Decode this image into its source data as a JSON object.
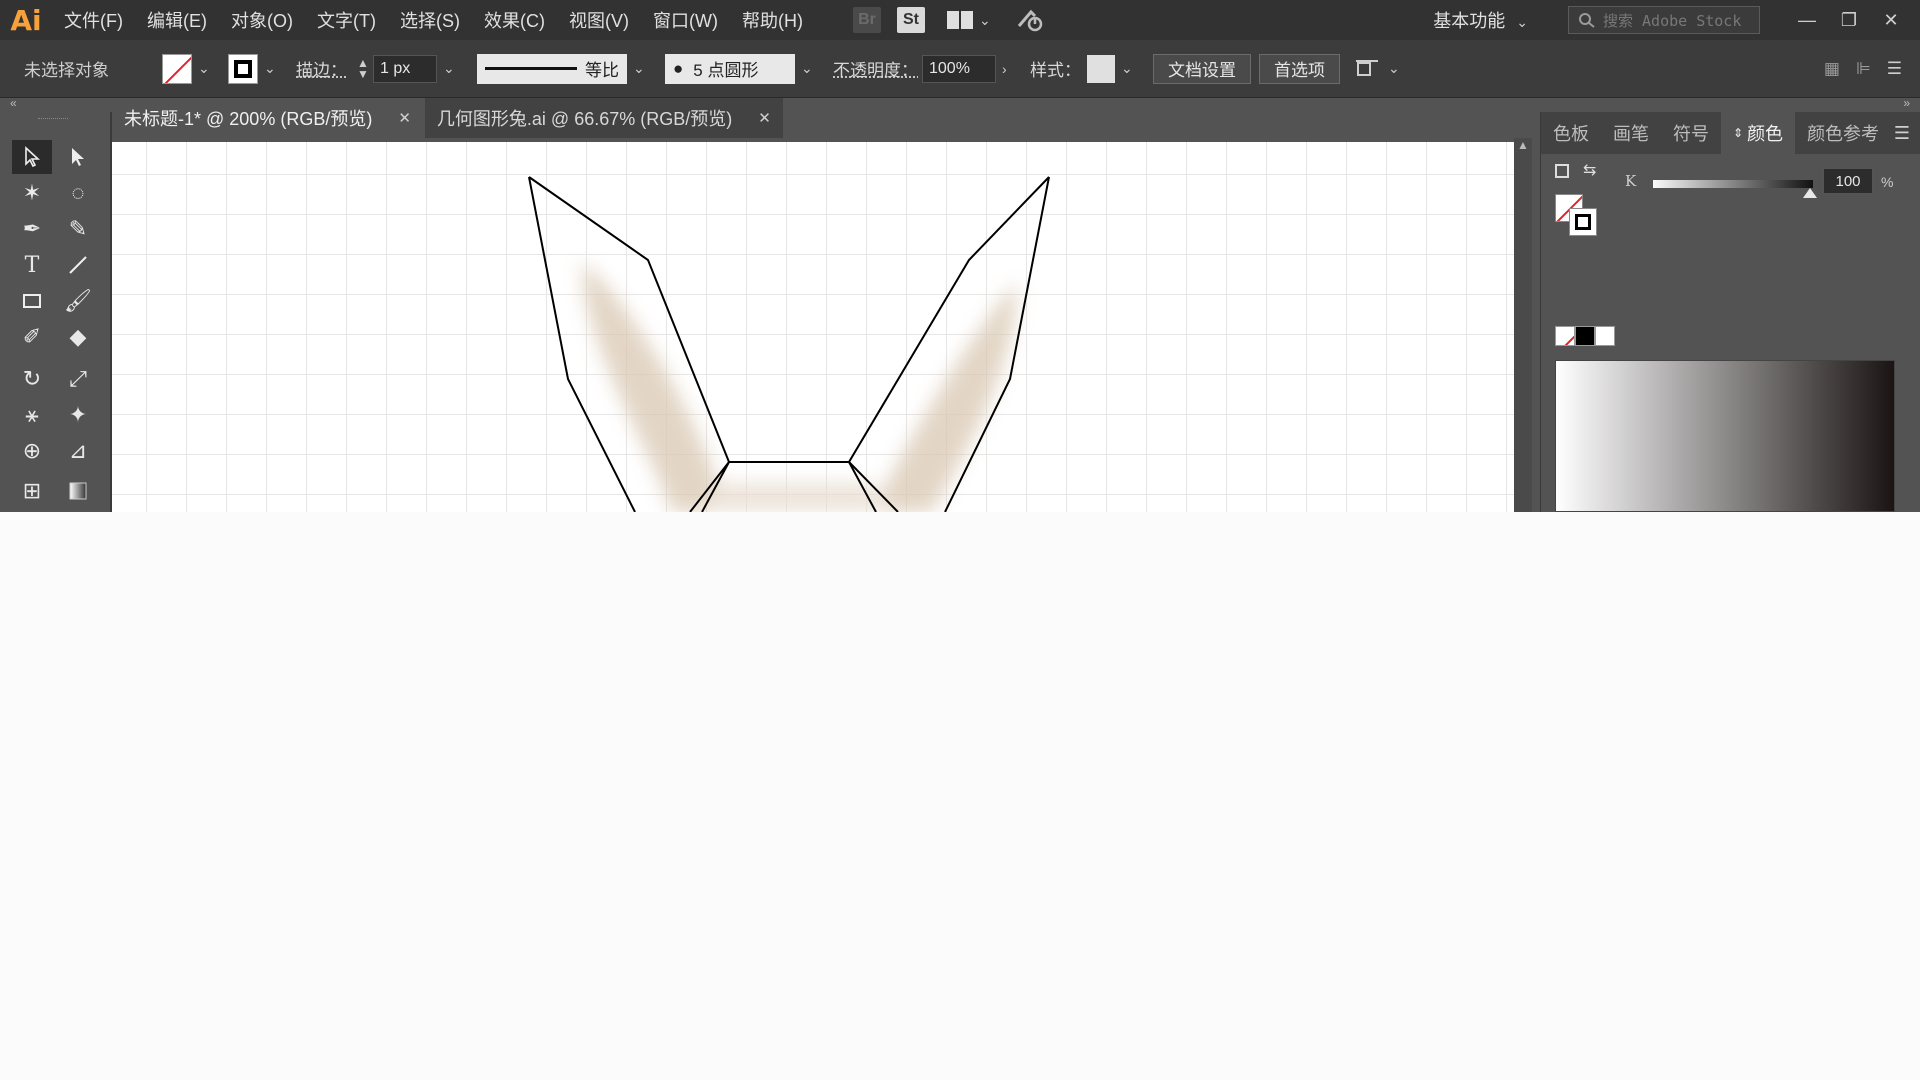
{
  "app": {
    "logo": "Ai"
  },
  "menu": [
    "文件(F)",
    "编辑(E)",
    "对象(O)",
    "文字(T)",
    "选择(S)",
    "效果(C)",
    "视图(V)",
    "窗口(W)",
    "帮助(H)"
  ],
  "menubar_icons": {
    "bridge": "Br",
    "stock": "St"
  },
  "workspace": "基本功能",
  "search": {
    "placeholder": "搜索 Adobe Stock"
  },
  "control": {
    "status": "未选择对象",
    "stroke_label": "描边：",
    "stroke_weight": "1 px",
    "stroke_profile": "等比",
    "brush": "5 点圆形",
    "opacity_label": "不透明度：",
    "opacity": "100%",
    "style_label": "样式：",
    "doc_setup": "文档设置",
    "prefs": "首选项"
  },
  "tabs": [
    {
      "label": "未标题-1* @ 200% (RGB/预览)",
      "active": true
    },
    {
      "label": "几何图形兔.ai @ 66.67% (RGB/预览)",
      "active": false
    }
  ],
  "panel": {
    "tabs": [
      "色板",
      "画笔",
      "符号",
      "颜色",
      "颜色参考"
    ],
    "active_tab": "颜色",
    "k_label": "K",
    "k_value": "100",
    "k_unit": "%"
  },
  "colors": {
    "accent_orange": "#f7a13c",
    "none_red": "#e2232a"
  },
  "icons": [
    "selection-tool-icon",
    "direct-selection-tool-icon",
    "magic-wand-icon",
    "lasso-icon",
    "pen-tool-icon",
    "curvature-tool-icon",
    "type-tool-icon",
    "line-tool-icon",
    "rectangle-tool-icon",
    "paintbrush-icon",
    "shaper-tool-icon",
    "eraser-icon",
    "rotate-tool-icon",
    "scale-tool-icon",
    "width-tool-icon",
    "puppet-warp-icon",
    "shape-builder-icon",
    "perspective-grid-icon",
    "mesh-tool-icon",
    "gradient-tool-icon"
  ]
}
